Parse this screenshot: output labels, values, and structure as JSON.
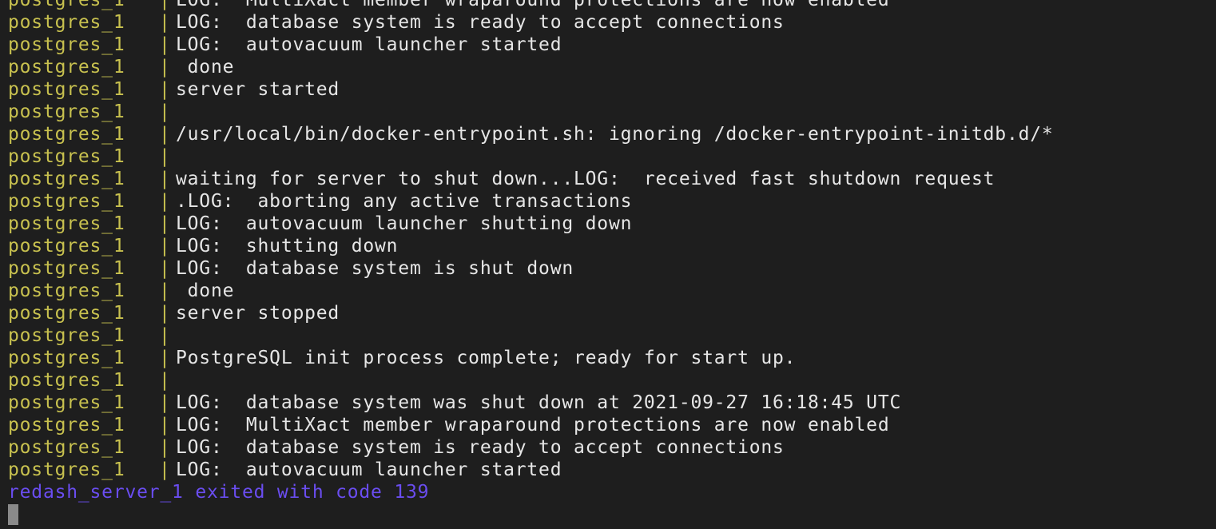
{
  "colors": {
    "background": "#1e1e1e",
    "text": "#e6e6e6",
    "service_name": "#c8c14f",
    "exit_message": "#6a4df0",
    "cursor": "#8a8a8a"
  },
  "log_lines": [
    {
      "service": "postgres_1",
      "pipe": "|",
      "message": "LOG:  MultiXact member wraparound protections are now enabled"
    },
    {
      "service": "postgres_1",
      "pipe": "|",
      "message": "LOG:  database system is ready to accept connections"
    },
    {
      "service": "postgres_1",
      "pipe": "|",
      "message": "LOG:  autovacuum launcher started"
    },
    {
      "service": "postgres_1",
      "pipe": "|",
      "message": " done"
    },
    {
      "service": "postgres_1",
      "pipe": "|",
      "message": "server started"
    },
    {
      "service": "postgres_1",
      "pipe": "|",
      "message": ""
    },
    {
      "service": "postgres_1",
      "pipe": "|",
      "message": "/usr/local/bin/docker-entrypoint.sh: ignoring /docker-entrypoint-initdb.d/*"
    },
    {
      "service": "postgres_1",
      "pipe": "|",
      "message": ""
    },
    {
      "service": "postgres_1",
      "pipe": "|",
      "message": "waiting for server to shut down...LOG:  received fast shutdown request"
    },
    {
      "service": "postgres_1",
      "pipe": "|",
      "message": ".LOG:  aborting any active transactions"
    },
    {
      "service": "postgres_1",
      "pipe": "|",
      "message": "LOG:  autovacuum launcher shutting down"
    },
    {
      "service": "postgres_1",
      "pipe": "|",
      "message": "LOG:  shutting down"
    },
    {
      "service": "postgres_1",
      "pipe": "|",
      "message": "LOG:  database system is shut down"
    },
    {
      "service": "postgres_1",
      "pipe": "|",
      "message": " done"
    },
    {
      "service": "postgres_1",
      "pipe": "|",
      "message": "server stopped"
    },
    {
      "service": "postgres_1",
      "pipe": "|",
      "message": ""
    },
    {
      "service": "postgres_1",
      "pipe": "|",
      "message": "PostgreSQL init process complete; ready for start up."
    },
    {
      "service": "postgres_1",
      "pipe": "|",
      "message": ""
    },
    {
      "service": "postgres_1",
      "pipe": "|",
      "message": "LOG:  database system was shut down at 2021-09-27 16:18:45 UTC"
    },
    {
      "service": "postgres_1",
      "pipe": "|",
      "message": "LOG:  MultiXact member wraparound protections are now enabled"
    },
    {
      "service": "postgres_1",
      "pipe": "|",
      "message": "LOG:  database system is ready to accept connections"
    },
    {
      "service": "postgres_1",
      "pipe": "|",
      "message": "LOG:  autovacuum launcher started"
    }
  ],
  "exit_message": "redash_server_1 exited with code 139"
}
